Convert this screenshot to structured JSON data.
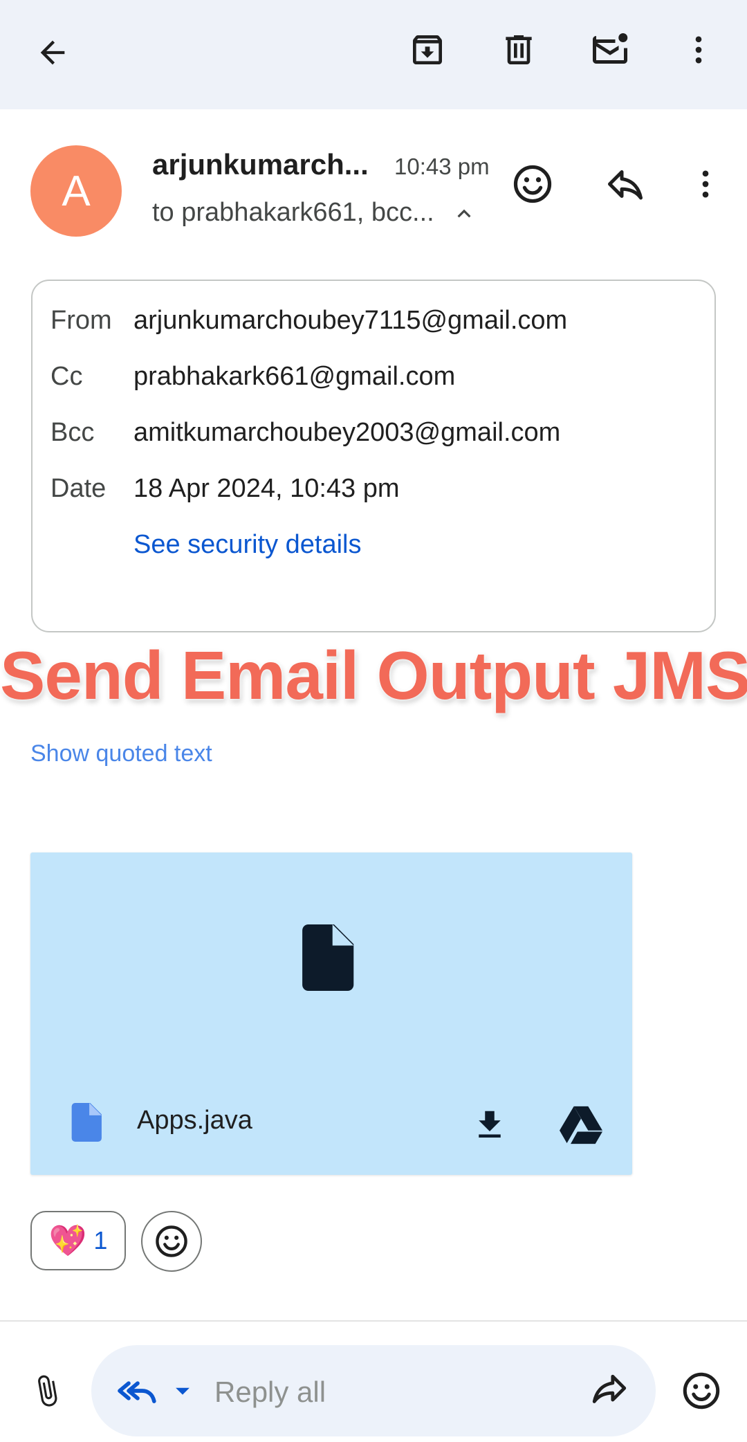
{
  "toolbar": {
    "back": "arrow-back-icon",
    "archive": "archive-icon",
    "delete": "trash-icon",
    "mark_unread": "mark-unread-icon",
    "more": "more-vert-icon"
  },
  "message": {
    "avatar_letter": "A",
    "avatar_color": "#f98b65",
    "sender": "arjunkumarch...",
    "time": "10:43 pm",
    "recipients": "to prabhakark661, bcc...",
    "details": {
      "from_label": "From",
      "from_value": "arjunkumarchoubey7115@gmail.com",
      "cc_label": "Cc",
      "cc_value": "prabhakark661@gmail.com",
      "bcc_label": "Bcc",
      "bcc_value": "amitkumarchoubey2003@gmail.com",
      "date_label": "Date",
      "date_value": "18 Apr 2024, 10:43 pm",
      "security_link": "See security details"
    }
  },
  "overlay_text": "Send Email Output JMS",
  "show_quoted": "Show quoted text",
  "attachment": {
    "filename": "Apps.java",
    "bg_color": "#c2e5fb"
  },
  "reactions": {
    "emoji": "💖",
    "count": "1"
  },
  "reply": {
    "placeholder": "Reply all"
  },
  "colors": {
    "accent": "#0b57d0",
    "overlay": "#f26a58",
    "topbar": "#eef2f9"
  }
}
